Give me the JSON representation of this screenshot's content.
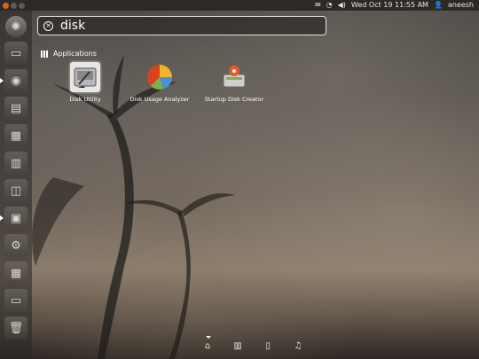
{
  "panel": {
    "datetime": "Wed Oct 19 11:55 AM",
    "username": "aneesh",
    "icons": [
      "mail-icon",
      "wifi-icon",
      "volume-icon",
      "user-icon"
    ]
  },
  "search": {
    "query": "disk"
  },
  "category": {
    "label": "Applications"
  },
  "results": [
    {
      "label": "Disk Utility",
      "icon": "disk-utility-icon",
      "selected": true
    },
    {
      "label": "Disk Usage Analyzer",
      "icon": "disk-usage-analyzer-icon",
      "selected": false
    },
    {
      "label": "Startup Disk Creator",
      "icon": "startup-disk-creator-icon",
      "selected": false
    }
  ],
  "lenses": [
    "home-lens-icon",
    "applications-lens-icon",
    "files-lens-icon",
    "music-lens-icon"
  ],
  "colors": {
    "panel": "#2b2a27",
    "close_button": "#e45a2a",
    "text": "#ffffff"
  }
}
